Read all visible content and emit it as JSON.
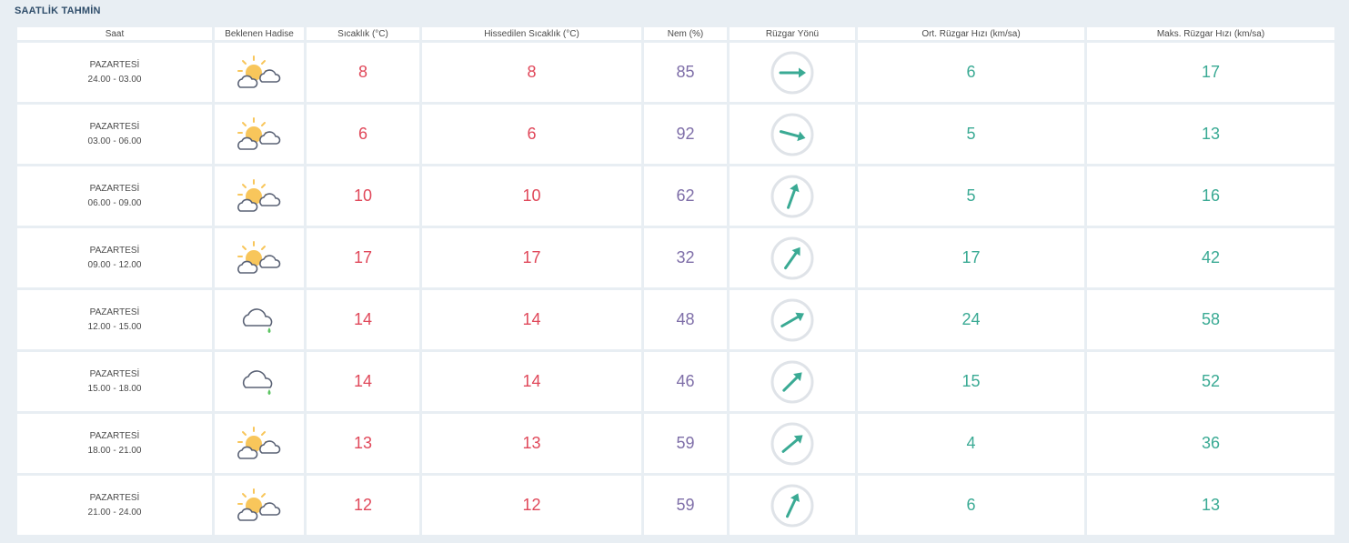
{
  "page": {
    "title": "SAATLİK TAHMİN"
  },
  "columns": [
    "Saat",
    "Beklenen Hadise",
    "Sıcaklık (°C)",
    "Hissedilen Sıcaklık (°C)",
    "Nem (%)",
    "Rüzgar Yönü",
    "Ort. Rüzgar Hızı (km/sa)",
    "Maks. Rüzgar Hızı (km/sa)"
  ],
  "colors": {
    "temperature": "#e0485a",
    "humidity": "#7e6ea8",
    "wind": "#3aaa94",
    "sun": "#f8c65b",
    "cloud_outline": "#5a6275",
    "rain_drop": "#5cc462",
    "compass_ring": "#dfe3e8"
  },
  "rows": [
    {
      "day": "PAZARTESİ",
      "time": "24.00 - 03.00",
      "icon": "partly-cloudy-icon",
      "temp": "8",
      "feels": "8",
      "humidity": "85",
      "wind_dir_deg": 90,
      "avg_wind": "6",
      "max_wind": "17"
    },
    {
      "day": "PAZARTESİ",
      "time": "03.00 - 06.00",
      "icon": "partly-cloudy-icon",
      "temp": "6",
      "feels": "6",
      "humidity": "92",
      "wind_dir_deg": 105,
      "avg_wind": "5",
      "max_wind": "13"
    },
    {
      "day": "PAZARTESİ",
      "time": "06.00 - 09.00",
      "icon": "partly-cloudy-icon",
      "temp": "10",
      "feels": "10",
      "humidity": "62",
      "wind_dir_deg": 20,
      "avg_wind": "5",
      "max_wind": "16"
    },
    {
      "day": "PAZARTESİ",
      "time": "09.00 - 12.00",
      "icon": "partly-cloudy-icon",
      "temp": "17",
      "feels": "17",
      "humidity": "32",
      "wind_dir_deg": 35,
      "avg_wind": "17",
      "max_wind": "42"
    },
    {
      "day": "PAZARTESİ",
      "time": "12.00 - 15.00",
      "icon": "light-rain-icon",
      "temp": "14",
      "feels": "14",
      "humidity": "48",
      "wind_dir_deg": 60,
      "avg_wind": "24",
      "max_wind": "58"
    },
    {
      "day": "PAZARTESİ",
      "time": "15.00 - 18.00",
      "icon": "light-rain-icon",
      "temp": "14",
      "feels": "14",
      "humidity": "46",
      "wind_dir_deg": 45,
      "avg_wind": "15",
      "max_wind": "52"
    },
    {
      "day": "PAZARTESİ",
      "time": "18.00 - 21.00",
      "icon": "partly-cloudy-icon",
      "temp": "13",
      "feels": "13",
      "humidity": "59",
      "wind_dir_deg": 50,
      "avg_wind": "4",
      "max_wind": "36"
    },
    {
      "day": "PAZARTESİ",
      "time": "21.00 - 24.00",
      "icon": "partly-cloudy-icon",
      "temp": "12",
      "feels": "12",
      "humidity": "59",
      "wind_dir_deg": 25,
      "avg_wind": "6",
      "max_wind": "13"
    }
  ]
}
